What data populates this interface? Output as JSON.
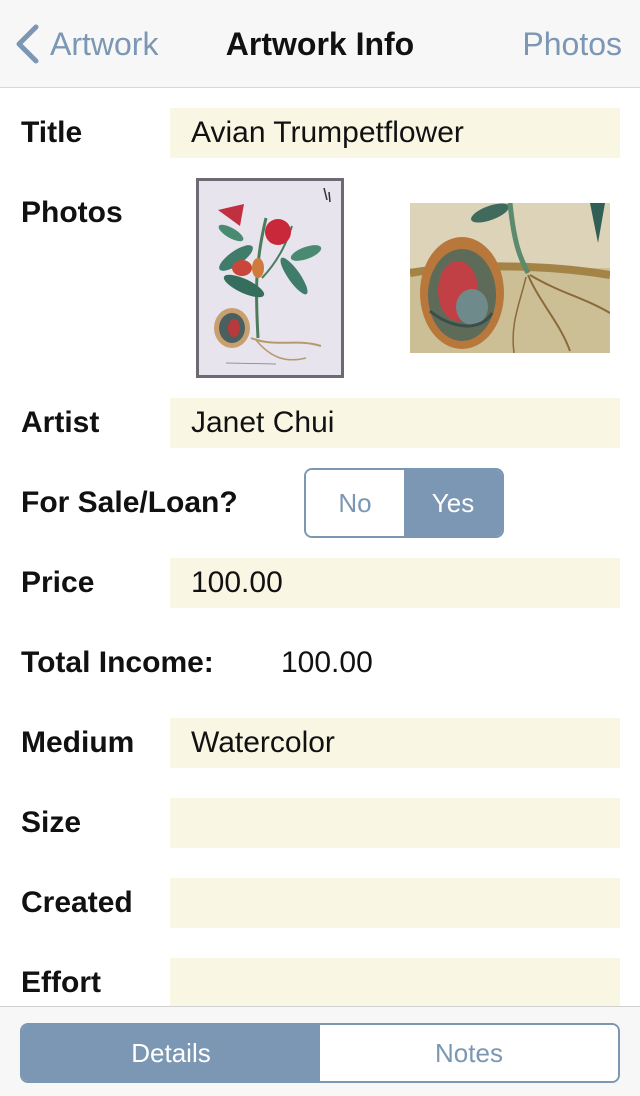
{
  "navbar": {
    "back_label": "Artwork",
    "title": "Artwork Info",
    "right_label": "Photos",
    "accent_color": "#7b97b3"
  },
  "form": {
    "title_label": "Title",
    "title_value": "Avian Trumpetflower",
    "photos_label": "Photos",
    "artist_label": "Artist",
    "artist_value": "Janet Chui",
    "for_sale_label": "For Sale/Loan?",
    "for_sale_options": [
      "No",
      "Yes"
    ],
    "for_sale_selected": "Yes",
    "price_label": "Price",
    "price_value": "100.00",
    "total_income_label": "Total Income:",
    "total_income_value": "100.00",
    "medium_label": "Medium",
    "medium_value": "Watercolor",
    "size_label": "Size",
    "size_value": "",
    "created_label": "Created",
    "created_value": "",
    "effort_label": "Effort",
    "effort_value": ""
  },
  "tabs": {
    "items": [
      "Details",
      "Notes"
    ],
    "selected": "Details"
  },
  "colors": {
    "field_background": "#faf6e4",
    "accent": "#7b97b3"
  }
}
